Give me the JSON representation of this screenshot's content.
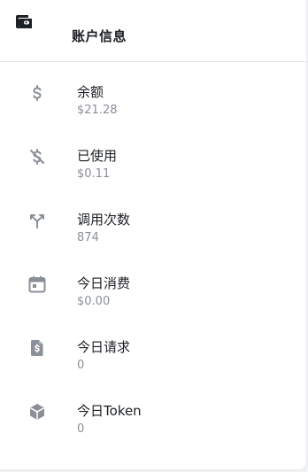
{
  "header": {
    "title": "账户信息",
    "icon": "wallet-icon"
  },
  "colors": {
    "icon": "#8a8f98",
    "title": "#1c1f23",
    "value": "#8a8f98",
    "header_icon": "#1c1f23"
  },
  "stats": [
    {
      "label": "余额",
      "value": "$21.28",
      "icon": "dollar-icon"
    },
    {
      "label": "已使用",
      "value": "$0.11",
      "icon": "dollar-off-icon"
    },
    {
      "label": "调用次数",
      "value": "874",
      "icon": "split-arrows-icon"
    },
    {
      "label": "今日消费",
      "value": "$0.00",
      "icon": "calendar-icon"
    },
    {
      "label": "今日请求",
      "value": "0",
      "icon": "file-dollar-icon"
    },
    {
      "label": "今日Token",
      "value": "0",
      "icon": "cube-icon"
    }
  ]
}
